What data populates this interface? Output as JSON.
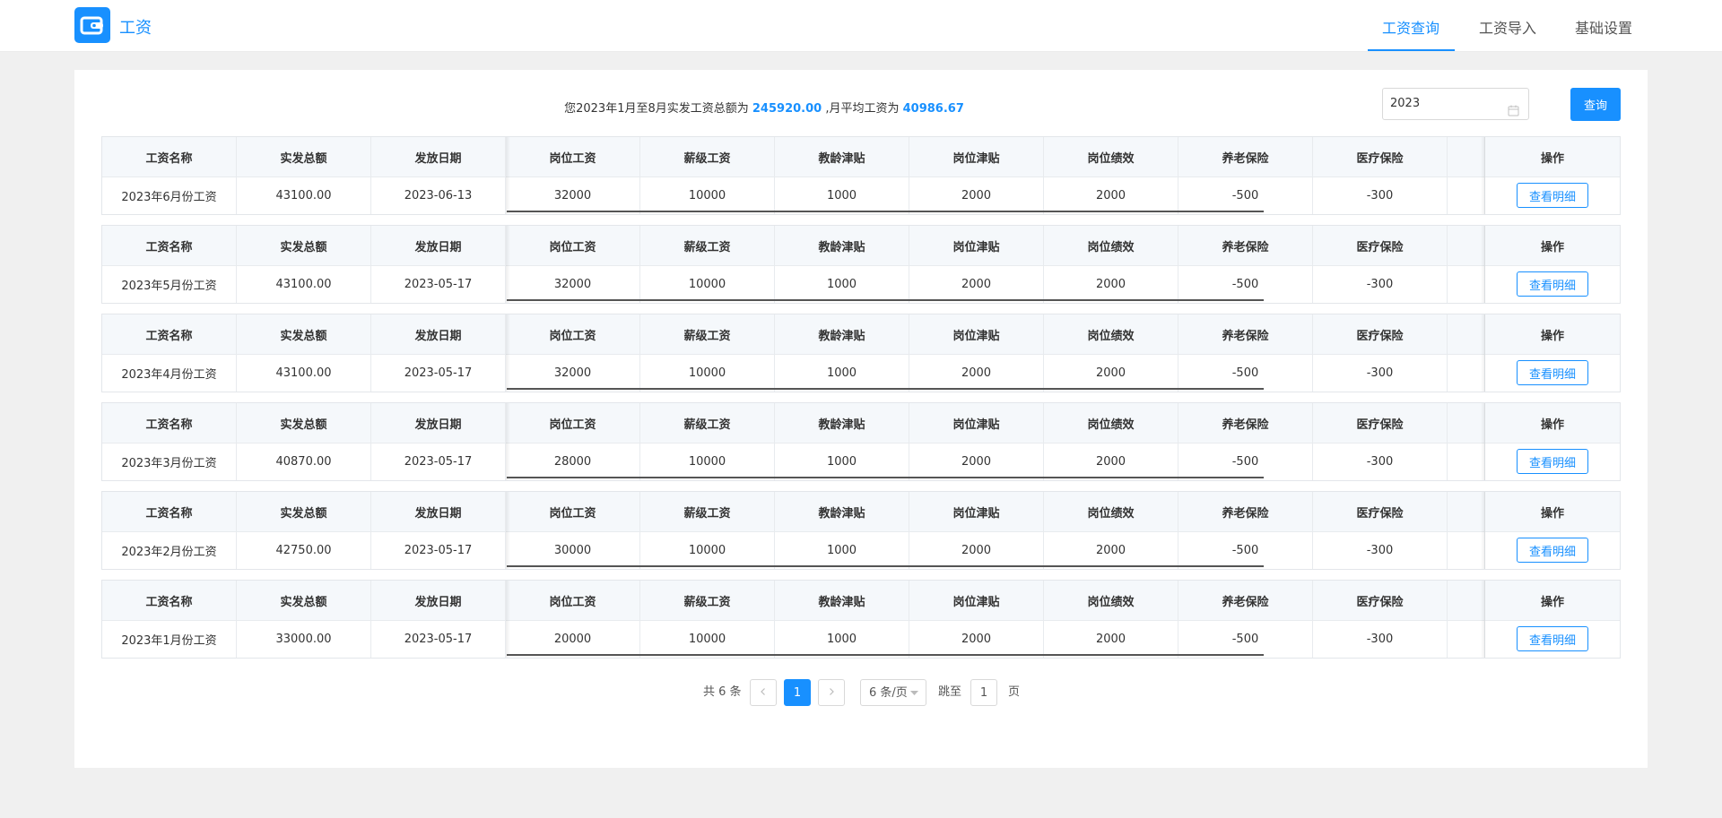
{
  "app": {
    "title": "工资"
  },
  "nav": [
    {
      "label": "工资查询",
      "active": true
    },
    {
      "label": "工资导入",
      "active": false
    },
    {
      "label": "基础设置",
      "active": false
    }
  ],
  "summary": {
    "prefix": "您2023年1月至8月实发工资总额为",
    "total": "245920.00",
    "middle": ",月平均工资为",
    "average": "40986.67"
  },
  "filter": {
    "year": "2023",
    "query_label": "查询"
  },
  "columns": [
    "工资名称",
    "实发总额",
    "发放日期",
    "岗位工资",
    "薪级工资",
    "教龄津贴",
    "岗位津贴",
    "岗位绩效",
    "养老保险",
    "医疗保险",
    "",
    "操作"
  ],
  "detail_label": "查看明细",
  "rows": [
    [
      "2023年6月份工资",
      "43100.00",
      "2023-06-13",
      "32000",
      "10000",
      "1000",
      "2000",
      "2000",
      "-500",
      "-300"
    ],
    [
      "2023年5月份工资",
      "43100.00",
      "2023-05-17",
      "32000",
      "10000",
      "1000",
      "2000",
      "2000",
      "-500",
      "-300"
    ],
    [
      "2023年4月份工资",
      "43100.00",
      "2023-05-17",
      "32000",
      "10000",
      "1000",
      "2000",
      "2000",
      "-500",
      "-300"
    ],
    [
      "2023年3月份工资",
      "40870.00",
      "2023-05-17",
      "28000",
      "10000",
      "1000",
      "2000",
      "2000",
      "-500",
      "-300"
    ],
    [
      "2023年2月份工资",
      "42750.00",
      "2023-05-17",
      "30000",
      "10000",
      "1000",
      "2000",
      "2000",
      "-500",
      "-300"
    ],
    [
      "2023年1月份工资",
      "33000.00",
      "2023-05-17",
      "20000",
      "10000",
      "1000",
      "2000",
      "2000",
      "-500",
      "-300"
    ]
  ],
  "pagination": {
    "total_text": "共 6 条",
    "current_page": "1",
    "page_size": "6 条/页",
    "jump_prefix": "跳至",
    "jump_value": "1",
    "jump_suffix": "页"
  },
  "colors": {
    "accent": "#1890ff",
    "header_bg": "#f5f8fb",
    "page_bg": "#f0f0f0"
  }
}
